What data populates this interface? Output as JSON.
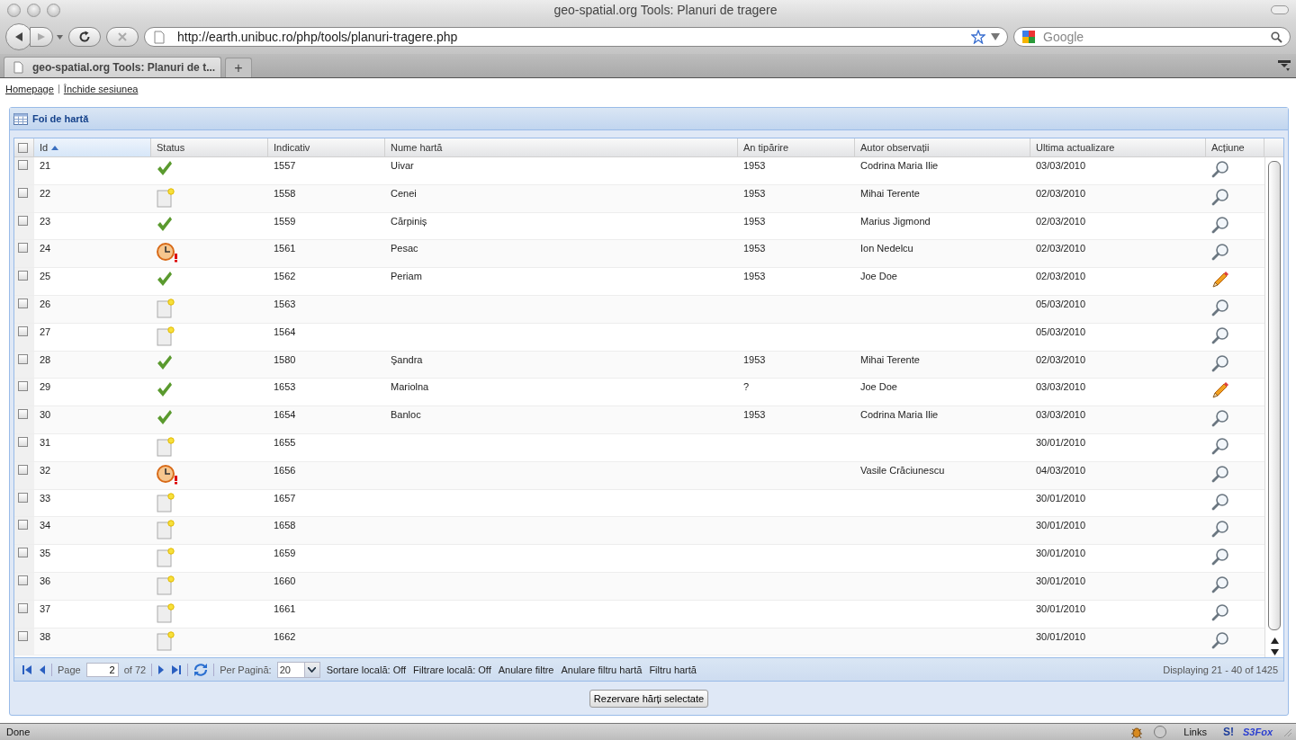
{
  "window": {
    "title": "geo-spatial.org Tools: Planuri de tragere"
  },
  "toolbar": {
    "url": "http://earth.unibuc.ro/php/tools/planuri-tragere.php",
    "search_placeholder": "Google"
  },
  "tabs": [
    {
      "label": "geo-spatial.org Tools: Planuri de t...",
      "selected": true
    },
    {
      "label": "+",
      "selected": false
    }
  ],
  "top_links": [
    "Homepage",
    "Închide sesiunea"
  ],
  "panel": {
    "title": "Foi de hartă"
  },
  "grid": {
    "select_all_checked": false,
    "columns": [
      {
        "label": "Id",
        "sorted": true
      },
      {
        "label": "Status",
        "sorted": false
      },
      {
        "label": "Indicativ",
        "sorted": false
      },
      {
        "label": "Nume hartă",
        "sorted": false
      },
      {
        "label": "An tipărire",
        "sorted": false
      },
      {
        "label": "Autor observații",
        "sorted": false
      },
      {
        "label": "Ultima actualizare",
        "sorted": false
      },
      {
        "label": "Acțiune",
        "sorted": false
      }
    ],
    "rows": [
      {
        "checked": false,
        "id": "21",
        "status": {
          "kind": "done"
        },
        "indicativ": "1557",
        "nume": "Uivar",
        "an": "1953",
        "autor": "Codrina Maria Ilie",
        "data": "03/03/2010",
        "action": {
          "kind": "view"
        }
      },
      {
        "checked": false,
        "id": "22",
        "status": {
          "kind": "new"
        },
        "indicativ": "1558",
        "nume": "Cenei",
        "an": "1953",
        "autor": "Mihai Terente",
        "data": "02/03/2010",
        "action": {
          "kind": "view"
        }
      },
      {
        "checked": false,
        "id": "23",
        "status": {
          "kind": "done"
        },
        "indicativ": "1559",
        "nume": "Cărpiniș",
        "an": "1953",
        "autor": "Marius Jigmond",
        "data": "02/03/2010",
        "action": {
          "kind": "view"
        }
      },
      {
        "checked": false,
        "id": "24",
        "status": {
          "kind": "pending"
        },
        "indicativ": "1561",
        "nume": "Pesac",
        "an": "1953",
        "autor": "Ion Nedelcu",
        "data": "02/03/2010",
        "action": {
          "kind": "view"
        }
      },
      {
        "checked": false,
        "id": "25",
        "status": {
          "kind": "done"
        },
        "indicativ": "1562",
        "nume": "Periam",
        "an": "1953",
        "autor": "Joe Doe",
        "data": "02/03/2010",
        "action": {
          "kind": "edit"
        }
      },
      {
        "checked": false,
        "id": "26",
        "status": {
          "kind": "new"
        },
        "indicativ": "1563",
        "data": "05/03/2010",
        "action": {
          "kind": "view"
        }
      },
      {
        "checked": false,
        "id": "27",
        "status": {
          "kind": "new"
        },
        "indicativ": "1564",
        "data": "05/03/2010",
        "action": {
          "kind": "view"
        }
      },
      {
        "checked": false,
        "id": "28",
        "status": {
          "kind": "done"
        },
        "indicativ": "1580",
        "nume": "Şandra",
        "an": "1953",
        "autor": "Mihai Terente",
        "data": "02/03/2010",
        "action": {
          "kind": "view"
        }
      },
      {
        "checked": false,
        "id": "29",
        "status": {
          "kind": "done"
        },
        "indicativ": "1653",
        "nume": "Mariolna",
        "an": "?",
        "autor": "Joe Doe",
        "data": "03/03/2010",
        "action": {
          "kind": "edit"
        }
      },
      {
        "checked": false,
        "id": "30",
        "status": {
          "kind": "done"
        },
        "indicativ": "1654",
        "nume": "Banloc",
        "an": "1953",
        "autor": "Codrina Maria Ilie",
        "data": "03/03/2010",
        "action": {
          "kind": "view"
        }
      },
      {
        "checked": false,
        "id": "31",
        "status": {
          "kind": "new"
        },
        "indicativ": "1655",
        "data": "30/01/2010",
        "action": {
          "kind": "view"
        }
      },
      {
        "checked": false,
        "id": "32",
        "status": {
          "kind": "pending"
        },
        "indicativ": "1656",
        "autor": "Vasile Crăciunescu",
        "data": "04/03/2010",
        "action": {
          "kind": "view"
        }
      },
      {
        "checked": false,
        "id": "33",
        "status": {
          "kind": "new"
        },
        "indicativ": "1657",
        "data": "30/01/2010",
        "action": {
          "kind": "view"
        }
      },
      {
        "checked": false,
        "id": "34",
        "status": {
          "kind": "new"
        },
        "indicativ": "1658",
        "data": "30/01/2010",
        "action": {
          "kind": "view"
        }
      },
      {
        "checked": false,
        "id": "35",
        "status": {
          "kind": "new"
        },
        "indicativ": "1659",
        "data": "30/01/2010",
        "action": {
          "kind": "view"
        }
      },
      {
        "checked": false,
        "id": "36",
        "status": {
          "kind": "new"
        },
        "indicativ": "1660",
        "data": "30/01/2010",
        "action": {
          "kind": "view"
        }
      },
      {
        "checked": false,
        "id": "37",
        "status": {
          "kind": "new"
        },
        "indicativ": "1661",
        "data": "30/01/2010",
        "action": {
          "kind": "view"
        }
      },
      {
        "checked": false,
        "id": "38",
        "status": {
          "kind": "new"
        },
        "indicativ": "1662",
        "data": "30/01/2010",
        "action": {
          "kind": "view"
        }
      }
    ]
  },
  "pager": {
    "page_label": "Page",
    "page": "2",
    "of_pages": "of 72",
    "per_page_label": "Per Pagină:",
    "per_page": "20",
    "items": [
      "Sortare locală: Off",
      "Filtrare locală: Off",
      "Anulare filtre",
      "Anulare filtru hartă",
      "Filtru hartă"
    ],
    "displaying": "Displaying 21 - 40 of 1425"
  },
  "button": "Rezervare hărți selectate",
  "status_bar": {
    "text": "Done",
    "links": "Links",
    "s_label": "S!",
    "s3fox": "S3Fox"
  }
}
